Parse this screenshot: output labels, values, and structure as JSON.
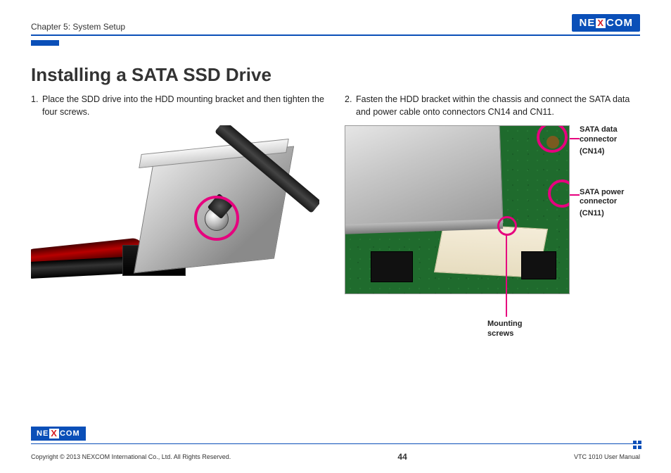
{
  "header": {
    "chapter": "Chapter 5: System Setup",
    "logo_pre": "NE",
    "logo_x": "X",
    "logo_post": "COM"
  },
  "title": "Installing a SATA SSD Drive",
  "steps": {
    "s1_num": "1.",
    "s1_text": "Place the SDD drive into the HDD mounting bracket and then tighten the four screws.",
    "s2_num": "2.",
    "s2_text": "Fasten the HDD bracket within the chassis and connect the SATA data and power cable onto connectors CN14 and CN11."
  },
  "labels": {
    "sata_data_title": "SATA data connector",
    "sata_data_sub": "(CN14)",
    "sata_power_title": "SATA power connector",
    "sata_power_sub": "(CN11)",
    "mounting_line1": "Mounting",
    "mounting_line2": "screws"
  },
  "footer": {
    "copyright": "Copyright © 2013 NEXCOM International Co., Ltd. All Rights Reserved.",
    "page": "44",
    "manual": "VTC 1010 User Manual",
    "logo_pre": "NE",
    "logo_x": "X",
    "logo_post": "COM"
  }
}
